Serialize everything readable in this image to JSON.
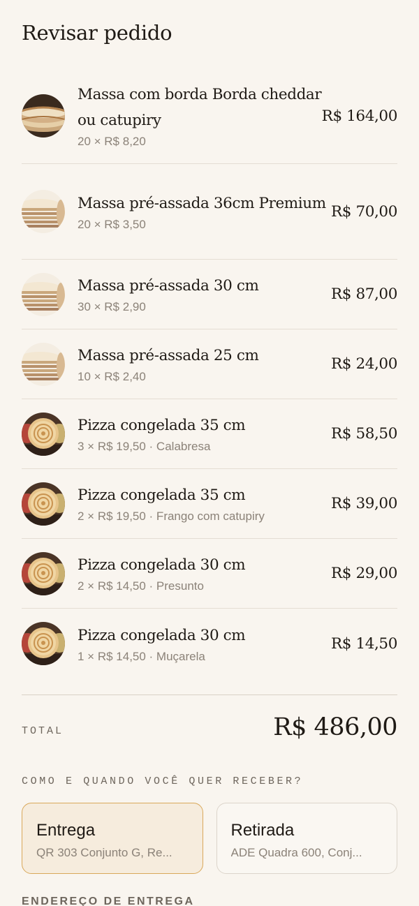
{
  "header": {
    "title": "Revisar pedido"
  },
  "items": [
    {
      "name": "Massa com borda Borda cheddar ou catupiry",
      "detail": "20 × R$ 8,20",
      "price": "R$ 164,00",
      "image": "stuffed-crust-dough-icon"
    },
    {
      "name": "Massa pré-assada 36cm Premium",
      "detail": "20 × R$ 3,50",
      "price": "R$ 70,00",
      "image": "prebaked-dough-icon"
    },
    {
      "name": "Massa pré-assada 30 cm",
      "detail": "30 × R$ 2,90",
      "price": "R$ 87,00",
      "image": "prebaked-dough-icon"
    },
    {
      "name": "Massa pré-assada 25 cm",
      "detail": "10 × R$ 2,40",
      "price": "R$ 24,00",
      "image": "prebaked-dough-icon"
    },
    {
      "name": "Pizza congelada 35 cm",
      "detail": "3 × R$ 19,50 · Calabresa",
      "price": "R$ 58,50",
      "image": "frozen-pizza-icon"
    },
    {
      "name": "Pizza congelada 35 cm",
      "detail": "2 × R$ 19,50 · Frango com catupiry",
      "price": "R$ 39,00",
      "image": "frozen-pizza-icon"
    },
    {
      "name": "Pizza congelada 30 cm",
      "detail": "2 × R$ 14,50 · Presunto",
      "price": "R$ 29,00",
      "image": "frozen-pizza-icon"
    },
    {
      "name": "Pizza congelada 30 cm",
      "detail": "1 × R$ 14,50 · Muçarela",
      "price": "R$ 14,50",
      "image": "frozen-pizza-icon"
    }
  ],
  "total": {
    "label": "TOTAL",
    "value": "R$ 486,00"
  },
  "delivery": {
    "section_label": "COMO E QUANDO VOCÊ QUER RECEBER?",
    "options": [
      {
        "title": "Entrega",
        "subtitle": "QR 303 Conjunto G, Re...",
        "selected": true
      },
      {
        "title": "Retirada",
        "subtitle": "ADE Quadra 600, Conj...",
        "selected": false
      }
    ]
  },
  "address": {
    "section_label": "ENDEREÇO DE ENTREGA"
  },
  "colors": {
    "background": "#f9f5ef",
    "accent": "#d9a85a",
    "selected_bg": "#f6ecdd",
    "muted_text": "#8b8278"
  }
}
